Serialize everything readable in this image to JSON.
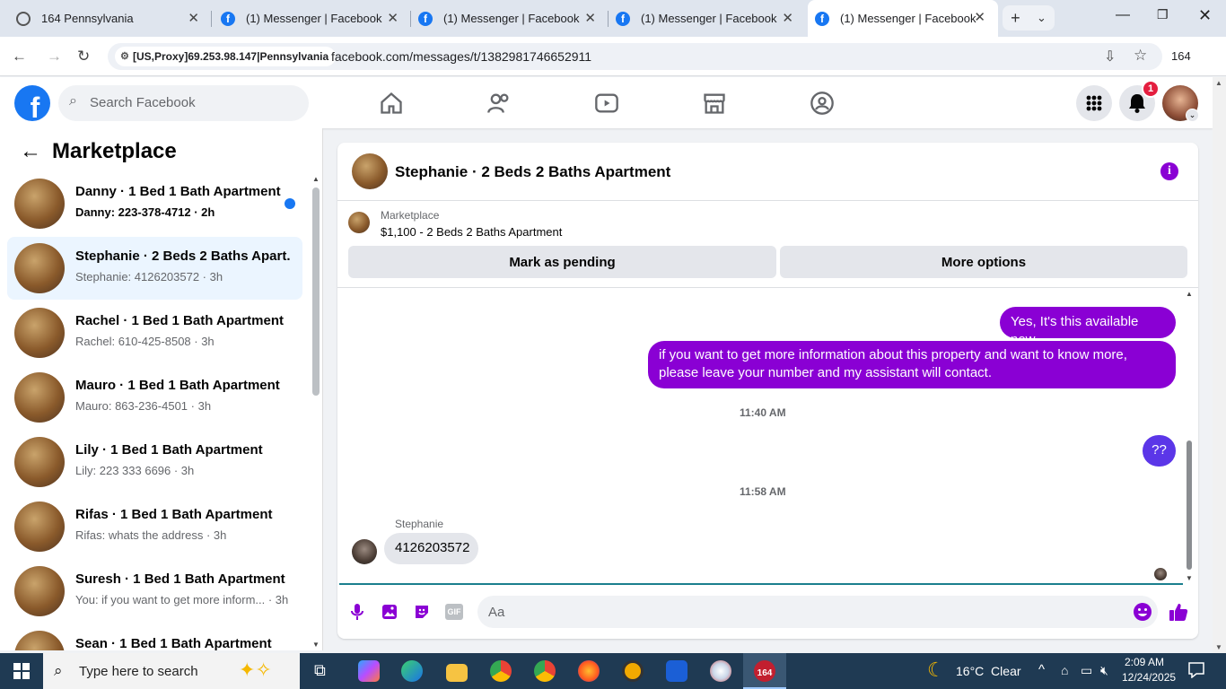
{
  "browser": {
    "tabs": [
      {
        "title": "164 Pennsylvania",
        "icon": "globe-icon",
        "active": false
      },
      {
        "title": "(1) Messenger | Facebook",
        "icon": "facebook-icon",
        "active": false
      },
      {
        "title": "(1) Messenger | Facebook",
        "icon": "facebook-icon",
        "active": false
      },
      {
        "title": "(1) Messenger | Facebook",
        "icon": "facebook-icon",
        "active": false
      },
      {
        "title": "(1) Messenger | Facebook",
        "icon": "facebook-icon",
        "active": true
      }
    ],
    "proxy_label": "[US,Proxy]69.253.98.147|Pennsylvania",
    "url": "facebook.com/messages/t/1382981746652911",
    "profile_label": "164"
  },
  "fb": {
    "search_placeholder": "Search Facebook",
    "notification_count": "1",
    "colors": {
      "blue": "#1877f2",
      "purple": "#8a00d4"
    }
  },
  "sidebar": {
    "title": "Marketplace",
    "conversations": [
      {
        "title": "Danny · 1 Bed 1 Bath Apartment",
        "preview": "Danny: 223-378-4712 · 2h",
        "unread": true
      },
      {
        "title": "Stephanie · 2 Beds 2 Baths Apart...",
        "preview": "Stephanie: 4126203572 · 3h",
        "selected": true
      },
      {
        "title": "Rachel · 1 Bed 1 Bath Apartment",
        "preview": "Rachel: 610-425-8508 · 3h"
      },
      {
        "title": "Mauro · 1 Bed 1 Bath Apartment",
        "preview": "Mauro: 863-236-4501 · 3h"
      },
      {
        "title": "Lily · 1 Bed 1 Bath Apartment",
        "preview": "Lily: 223 333 6696 · 3h"
      },
      {
        "title": "Rifas · 1 Bed 1 Bath Apartment",
        "preview": "Rifas: whats the address · 3h"
      },
      {
        "title": "Suresh · 1 Bed 1 Bath Apartment",
        "preview": "You: if you want to get more inform... · 3h"
      },
      {
        "title": "Sean · 1 Bed 1 Bath Apartment",
        "preview": ""
      }
    ]
  },
  "chat": {
    "title": "Stephanie · 2 Beds 2 Baths Apartment",
    "listing_label": "Marketplace",
    "listing_price": "$1,100 - 2 Beds 2 Baths Apartment",
    "mark_pending_label": "Mark as pending",
    "more_options_label": "More options",
    "messages": [
      {
        "from": "me",
        "text": "Yes, It's this available now."
      },
      {
        "from": "me",
        "text": "if you want to get more information about this property and want to know more, please leave your number and my assistant will contact."
      },
      {
        "timestamp": "11:40 AM"
      },
      {
        "from": "me",
        "text": "??"
      },
      {
        "timestamp": "11:58 AM"
      },
      {
        "from": "Stephanie",
        "sender_label": "Stephanie",
        "text": "4126203572"
      }
    ],
    "composer_placeholder": "Aa"
  },
  "taskbar": {
    "search_placeholder": "Type here to search",
    "weather": "16°C  Clear",
    "time": "2:09 AM",
    "date": "12/24/2025",
    "active_app_label": "164"
  }
}
